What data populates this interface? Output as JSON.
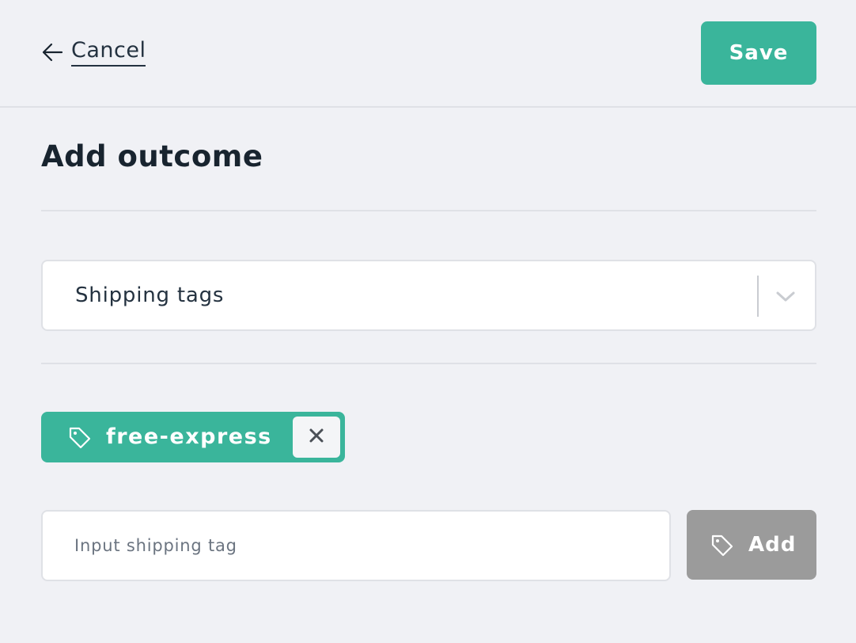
{
  "header": {
    "cancel_label": "Cancel",
    "save_label": "Save"
  },
  "page": {
    "title": "Add outcome"
  },
  "outcome_select": {
    "selected": "Shipping tags"
  },
  "tags": [
    {
      "label": "free-express"
    }
  ],
  "tag_input": {
    "value": "",
    "placeholder": "Input shipping tag"
  },
  "add_button": {
    "label": "Add"
  },
  "icons": {
    "back": "arrow-left-icon",
    "chevron": "chevron-down-icon",
    "tag": "tag-icon",
    "remove": "close-icon"
  },
  "colors": {
    "accent": "#3ab59b",
    "background": "#f0f1f5",
    "disabled_button": "#9b9b9b",
    "text": "#18242f"
  }
}
